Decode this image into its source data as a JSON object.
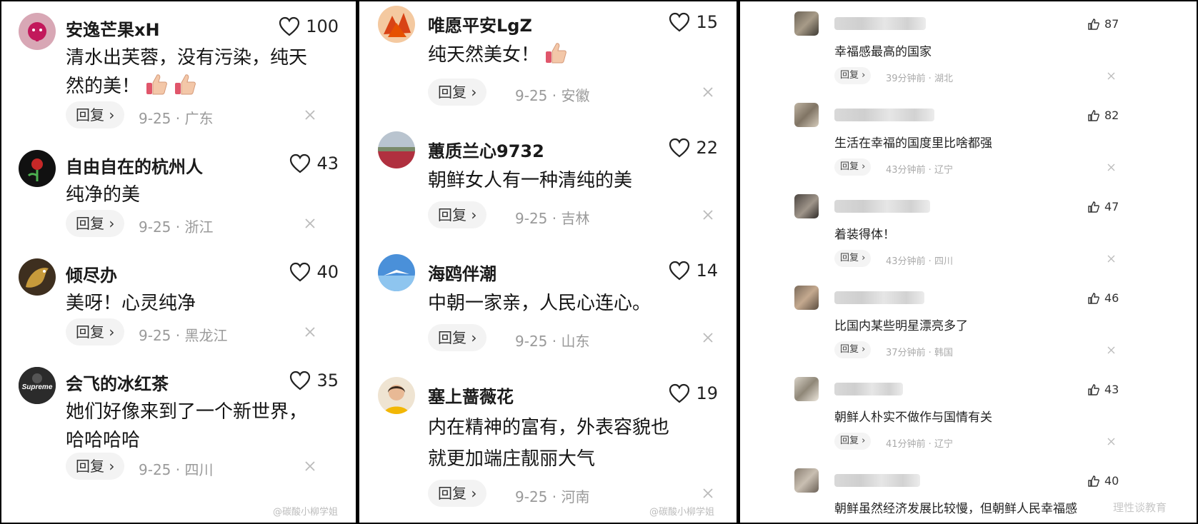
{
  "ui": {
    "reply_label": "回复 ›",
    "sep": " · "
  },
  "panel1": {
    "comments": [
      {
        "username": "安逸芒果xH",
        "likes": "100",
        "text1": "清水出芙蓉，没有污染，纯天",
        "text2": "然的美！",
        "date": "9-25",
        "region": "广东",
        "emoji": "thumbs-up-icon"
      },
      {
        "username": "自由自在的杭州人",
        "likes": "43",
        "text1": "纯净的美",
        "date": "9-25",
        "region": "浙江"
      },
      {
        "username": "倾尽办",
        "likes": "40",
        "text1": "美呀！心灵纯净",
        "date": "9-25",
        "region": "黑龙江"
      },
      {
        "username": "会飞的冰红茶",
        "likes": "35",
        "text1": "她们好像来到了一个新世界，",
        "text2": "哈哈哈哈",
        "date": "9-25",
        "region": "四川",
        "avatar_text": "Supreme"
      }
    ],
    "watermark": "@碳酸小柳学姐"
  },
  "panel2": {
    "comments": [
      {
        "username": "唯愿平安LgZ",
        "likes": "15",
        "text1": "纯天然美女！",
        "date": "9-25",
        "region": "安徽",
        "emoji": "thumbs-up-icon"
      },
      {
        "username": "蕙质兰心9732",
        "likes": "22",
        "text1": "朝鲜女人有一种清纯的美",
        "date": "9-25",
        "region": "吉林"
      },
      {
        "username": "海鸥伴潮",
        "likes": "14",
        "text1": "中朝一家亲，人民心连心。",
        "date": "9-25",
        "region": "山东"
      },
      {
        "username": "塞上蔷薇花",
        "likes": "19",
        "text1": "内在精神的富有，外表容貌也",
        "text2": "就更加端庄靓丽大气",
        "date": "9-25",
        "region": "河南"
      }
    ],
    "watermark": "@碳酸小柳学姐"
  },
  "panel3": {
    "comments": [
      {
        "likes": "87",
        "text": "幸福感最高的国家",
        "time": "39分钟前",
        "region": "湖北"
      },
      {
        "likes": "82",
        "text": "生活在幸福的国度里比啥都强",
        "time": "43分钟前",
        "region": "辽宁"
      },
      {
        "likes": "47",
        "text": "着装得体！",
        "time": "43分钟前",
        "region": "四川"
      },
      {
        "likes": "46",
        "text": "比国内某些明星漂亮多了",
        "time": "37分钟前",
        "region": "韩国"
      },
      {
        "likes": "43",
        "text": "朝鲜人朴实不做作与国情有关",
        "time": "41分钟前",
        "region": "辽宁"
      },
      {
        "likes": "40",
        "text": "朝鲜虽然经济发展比较慢，但朝鲜人民幸福感"
      }
    ],
    "watermark": "理性谈教育"
  }
}
